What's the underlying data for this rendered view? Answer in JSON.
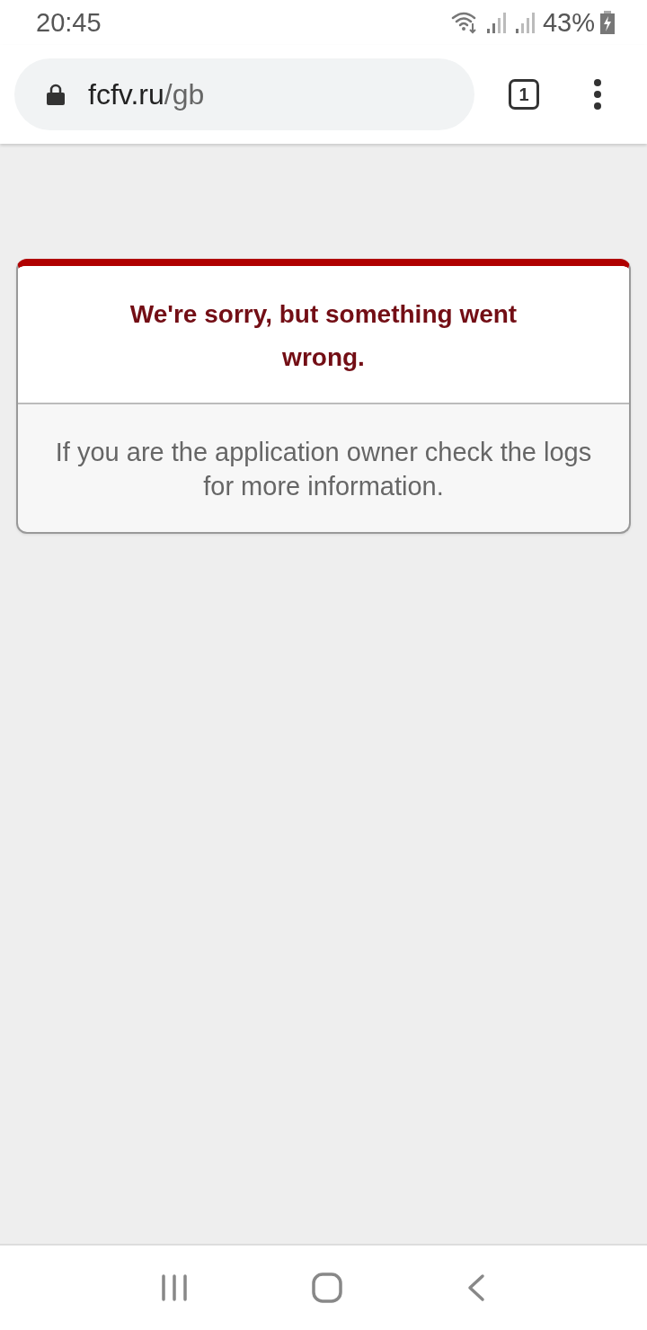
{
  "status_bar": {
    "time": "20:45",
    "battery": "43%"
  },
  "browser": {
    "url_host": "fcfv.ru",
    "url_path": "/gb",
    "tab_count": "1"
  },
  "error_card": {
    "title": "We're sorry, but something went wrong.",
    "message": "If you are the application owner check the logs for more information."
  }
}
